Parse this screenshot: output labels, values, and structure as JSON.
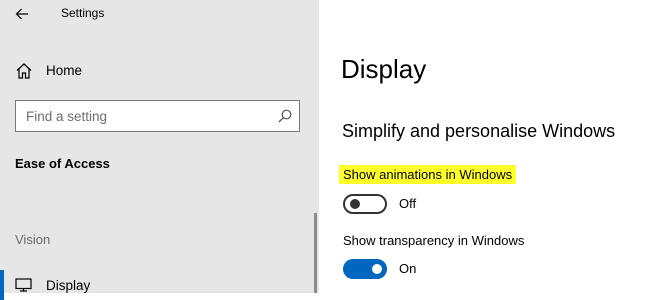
{
  "window": {
    "title": "Settings"
  },
  "sidebar": {
    "home_label": "Home",
    "search": {
      "placeholder": "Find a setting",
      "value": ""
    },
    "category_title": "Ease of Access",
    "group_label": "Vision",
    "items": [
      {
        "label": "Display",
        "icon": "monitor-icon",
        "selected": true
      }
    ]
  },
  "main": {
    "page_title": "Display",
    "section_title": "Simplify and personalise Windows",
    "settings": [
      {
        "label": "Show animations in Windows",
        "highlighted": true,
        "highlight_color": "#ffff2a",
        "state": "Off",
        "on": false
      },
      {
        "label": "Show transparency in Windows",
        "highlighted": false,
        "state": "On",
        "on": true,
        "accent_color": "#0067c0"
      }
    ]
  }
}
